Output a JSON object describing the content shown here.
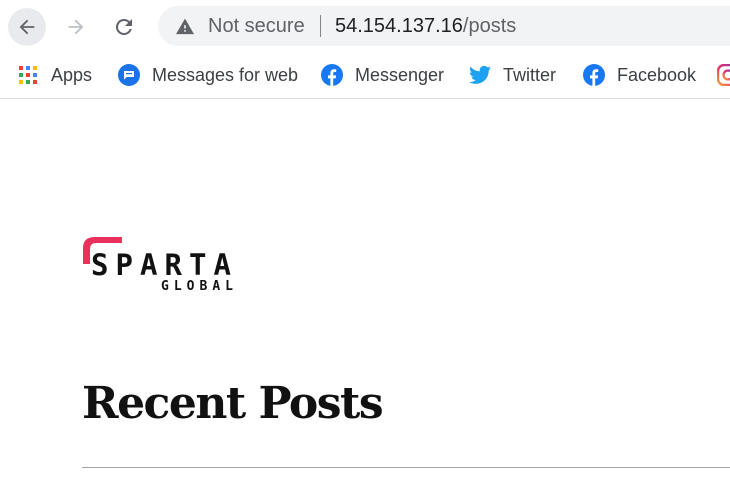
{
  "browser": {
    "security_label": "Not secure",
    "url_host": "54.154.137.16",
    "url_path": "/posts"
  },
  "bookmarks": [
    {
      "label": "Apps",
      "icon": "apps-grid-icon"
    },
    {
      "label": "Messages for web",
      "icon": "messages-icon",
      "color": "#1a73e8"
    },
    {
      "label": "Messenger",
      "icon": "facebook-icon",
      "color": "#1877f2"
    },
    {
      "label": "Twitter",
      "icon": "twitter-icon",
      "color": "#1da1f2"
    },
    {
      "label": "Facebook",
      "icon": "facebook-icon",
      "color": "#1877f2"
    },
    {
      "label": "",
      "icon": "instagram-icon"
    }
  ],
  "page": {
    "logo_main": "SPARTA",
    "logo_sub": "GLOBAL",
    "logo_accent_color": "#e8315b",
    "title": "Recent Posts"
  }
}
